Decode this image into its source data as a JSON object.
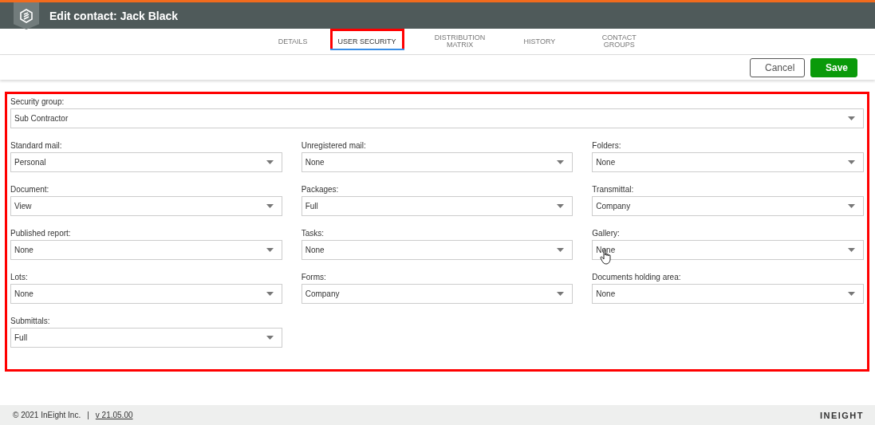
{
  "window": {
    "title": "Edit contact: Jack Black"
  },
  "tabs": [
    {
      "label": "DETAILS",
      "selected": false,
      "highlighted": false
    },
    {
      "label": "USER SECURITY",
      "selected": true,
      "highlighted": true
    },
    {
      "label": "DISTRIBUTION MATRIX",
      "selected": false,
      "highlighted": false
    },
    {
      "label": "HISTORY",
      "selected": false,
      "highlighted": false
    },
    {
      "label": "CONTACT GROUPS",
      "selected": false,
      "highlighted": false
    }
  ],
  "actions": [
    {
      "label": "Cancel",
      "kind": "secondary"
    },
    {
      "label": "Save",
      "kind": "primary"
    }
  ],
  "form": {
    "highlighted": true,
    "security_group": {
      "label": "Security group:",
      "value": "Sub Contractor"
    },
    "fields": [
      {
        "label": "Standard mail:",
        "value": "Personal",
        "hovered": false
      },
      {
        "label": "Unregistered mail:",
        "value": "None",
        "hovered": false
      },
      {
        "label": "Folders:",
        "value": "None",
        "hovered": false
      },
      {
        "label": "Document:",
        "value": "View",
        "hovered": false
      },
      {
        "label": "Packages:",
        "value": "Full",
        "hovered": false
      },
      {
        "label": "Transmittal:",
        "value": "Company",
        "hovered": false
      },
      {
        "label": "Published report:",
        "value": "None",
        "hovered": false
      },
      {
        "label": "Tasks:",
        "value": "None",
        "hovered": false
      },
      {
        "label": "Gallery:",
        "value": "None",
        "hovered": true
      },
      {
        "label": "Lots:",
        "value": "None",
        "hovered": false
      },
      {
        "label": "Forms:",
        "value": "Company",
        "hovered": false
      },
      {
        "label": "Documents holding area:",
        "value": "None",
        "hovered": false
      },
      {
        "label": "Submittals:",
        "value": "Full",
        "hovered": false
      }
    ]
  },
  "footer": {
    "copyright": "© 2021 InEight Inc.",
    "separator": "|",
    "version": "v 21.05.00",
    "brand": "INEIGHT"
  }
}
